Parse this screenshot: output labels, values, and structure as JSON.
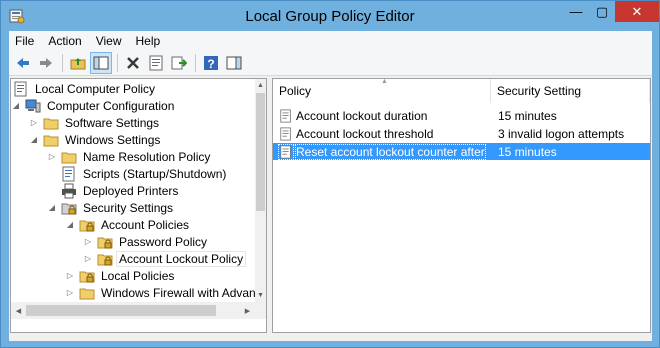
{
  "window": {
    "title": "Local Group Policy Editor",
    "close_symbol": "✕",
    "minimize_symbol": "—",
    "maximize_symbol": "▢"
  },
  "menubar": {
    "items": [
      "File",
      "Action",
      "View",
      "Help"
    ]
  },
  "toolbar": {
    "buttons": [
      "back-icon",
      "forward-icon",
      "up-folder-icon",
      "show-hide-tree-icon",
      "delete-icon",
      "properties-icon",
      "export-list-icon",
      "help-icon",
      "show-hide-action-pane-icon"
    ]
  },
  "tree": {
    "items": [
      {
        "label": "Local Computer Policy",
        "icon": "policy-computer-icon",
        "level": 0,
        "twisty": ""
      },
      {
        "label": "Computer Configuration",
        "icon": "computer-icon",
        "level": 1,
        "twisty": "expanded"
      },
      {
        "label": "Software Settings",
        "icon": "folder-icon",
        "level": 2,
        "twisty": "collapsed"
      },
      {
        "label": "Windows Settings",
        "icon": "folder-icon",
        "level": 2,
        "twisty": "expanded"
      },
      {
        "label": "Name Resolution Policy",
        "icon": "folder-icon",
        "level": 3,
        "twisty": "collapsed"
      },
      {
        "label": "Scripts (Startup/Shutdown)",
        "icon": "script-icon",
        "level": 3,
        "twisty": ""
      },
      {
        "label": "Deployed Printers",
        "icon": "printer-icon",
        "level": 3,
        "twisty": ""
      },
      {
        "label": "Security Settings",
        "icon": "security-icon",
        "level": 3,
        "twisty": "expanded"
      },
      {
        "label": "Account Policies",
        "icon": "locked-folder-icon",
        "level": 4,
        "twisty": "expanded"
      },
      {
        "label": "Password Policy",
        "icon": "locked-folder-icon",
        "level": 5,
        "twisty": "collapsed"
      },
      {
        "label": "Account Lockout Policy",
        "icon": "locked-folder-icon",
        "level": 5,
        "twisty": "collapsed",
        "selected": true
      },
      {
        "label": "Local Policies",
        "icon": "locked-folder-icon",
        "level": 4,
        "twisty": "collapsed"
      },
      {
        "label": "Windows Firewall with Advan",
        "icon": "folder-icon",
        "level": 4,
        "twisty": "collapsed"
      }
    ]
  },
  "list": {
    "columns": [
      "Policy",
      "Security Setting"
    ],
    "rows": [
      {
        "policy": "Account lockout duration",
        "setting": "15 minutes",
        "selected": false
      },
      {
        "policy": "Account lockout threshold",
        "setting": "3 invalid logon attempts",
        "selected": false
      },
      {
        "policy": "Reset account lockout counter after",
        "setting": "15 minutes",
        "selected": true
      }
    ]
  },
  "colors": {
    "title_bar": "#6fb0de",
    "close_button": "#c7372f",
    "selection": "#3399ff"
  }
}
